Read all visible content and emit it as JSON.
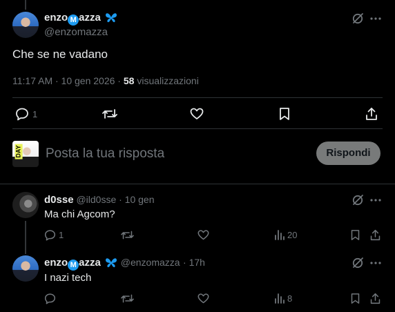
{
  "main_tweet": {
    "author_name_prefix": "enzo",
    "author_name_badge": "M",
    "author_name_suffix": "azza",
    "author_handle": "@enzomazza",
    "text": "Che se ne vadano",
    "meta_time": "11:17 AM · 10 gen 2026 · ",
    "meta_views_count": "58",
    "meta_views_label": " visualizzazioni",
    "actions": {
      "reply_count": "1",
      "icons": [
        "reply-icon",
        "retweet-icon",
        "like-icon",
        "bookmark-icon",
        "share-icon"
      ]
    }
  },
  "compose": {
    "placeholder": "Posta la tua risposta",
    "button_label": "Rispondi",
    "avatar_badge": "DAY"
  },
  "replies": [
    {
      "author_name": "d0sse",
      "author_handle": "@ild0sse",
      "time": "· 10 gen",
      "text": "Ma chi Agcom?",
      "reply_count": "1",
      "views": "20"
    },
    {
      "author_name_prefix": "enzo",
      "author_name_badge": "M",
      "author_name_suffix": "azza",
      "author_handle": "@enzomazza",
      "time": "· 17h",
      "text": "I nazi tech",
      "views": "8"
    }
  ],
  "colors": {
    "background": "#000000",
    "text": "#e7e9ea",
    "muted": "#71767b",
    "accent": "#1d9bf0",
    "reply_button_bg": "#787a7a"
  }
}
